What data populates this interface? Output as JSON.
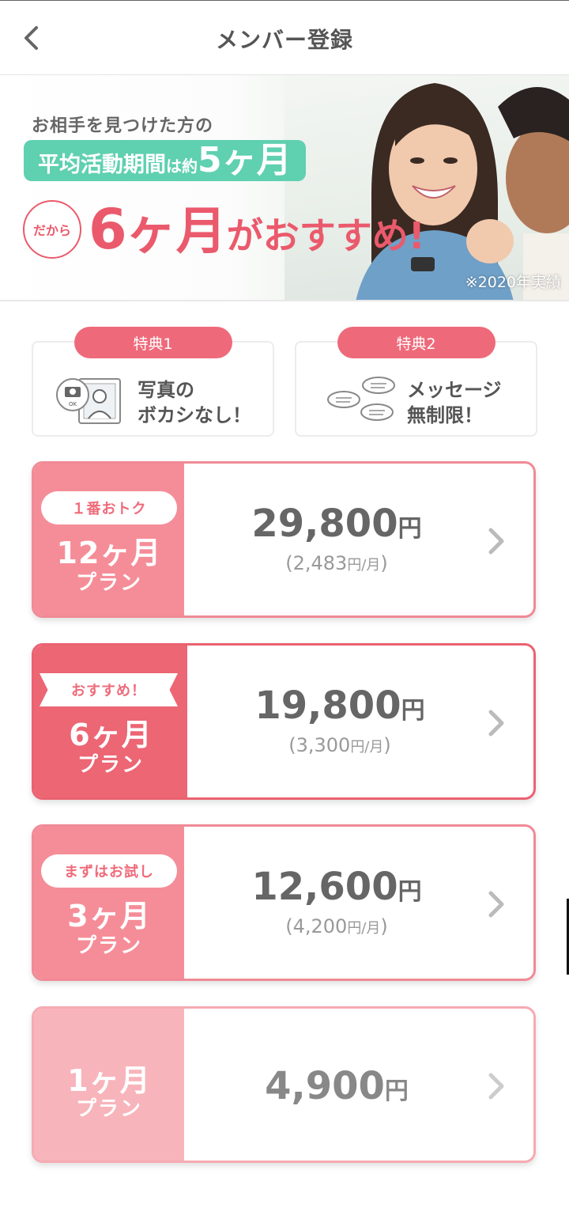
{
  "header": {
    "title": "メンバー登録",
    "back_icon": "chevron-left-icon"
  },
  "banner": {
    "line1": "お相手を見つけた方の",
    "pill_a": "平均活動期間",
    "pill_b": "は約",
    "pill_c": "5ヶ月",
    "circle": "だから",
    "big_num": "6",
    "big_month": "ヶ月",
    "big_suffix": "がおすすめ!",
    "note": "※2020年実績"
  },
  "benefits": [
    {
      "tag": "特典1",
      "text": "写真の\nボカシなし！",
      "icon": "photo-unblur-icon"
    },
    {
      "tag": "特典2",
      "text": "メッセージ\n無制限！",
      "icon": "message-bubbles-icon"
    }
  ],
  "plans": [
    {
      "badge": "１番おトク",
      "months": "12ヶ月",
      "label": "プラン",
      "price": "29,800",
      "yen": "円",
      "monthly_open": "(2,483",
      "monthly_unit": "円/月",
      "monthly_close": ")"
    },
    {
      "badge": "おすすめ！",
      "months": "6ヶ月",
      "label": "プラン",
      "price": "19,800",
      "yen": "円",
      "monthly_open": "(3,300",
      "monthly_unit": "円/月",
      "monthly_close": ")"
    },
    {
      "badge": "まずはお試し",
      "months": "3ヶ月",
      "label": "プラン",
      "price": "12,600",
      "yen": "円",
      "monthly_open": "(4,200",
      "monthly_unit": "円/月",
      "monthly_close": ")"
    },
    {
      "months": "1ヶ月",
      "label": "プラン",
      "price": "4,900",
      "yen": "円"
    }
  ],
  "colors": {
    "accent": "#ea5a6c",
    "teal": "#5fd0b0",
    "plan_light": "#f58d98",
    "plan_dark": "#ec6674",
    "plan_pale": "#f8b4bb"
  }
}
